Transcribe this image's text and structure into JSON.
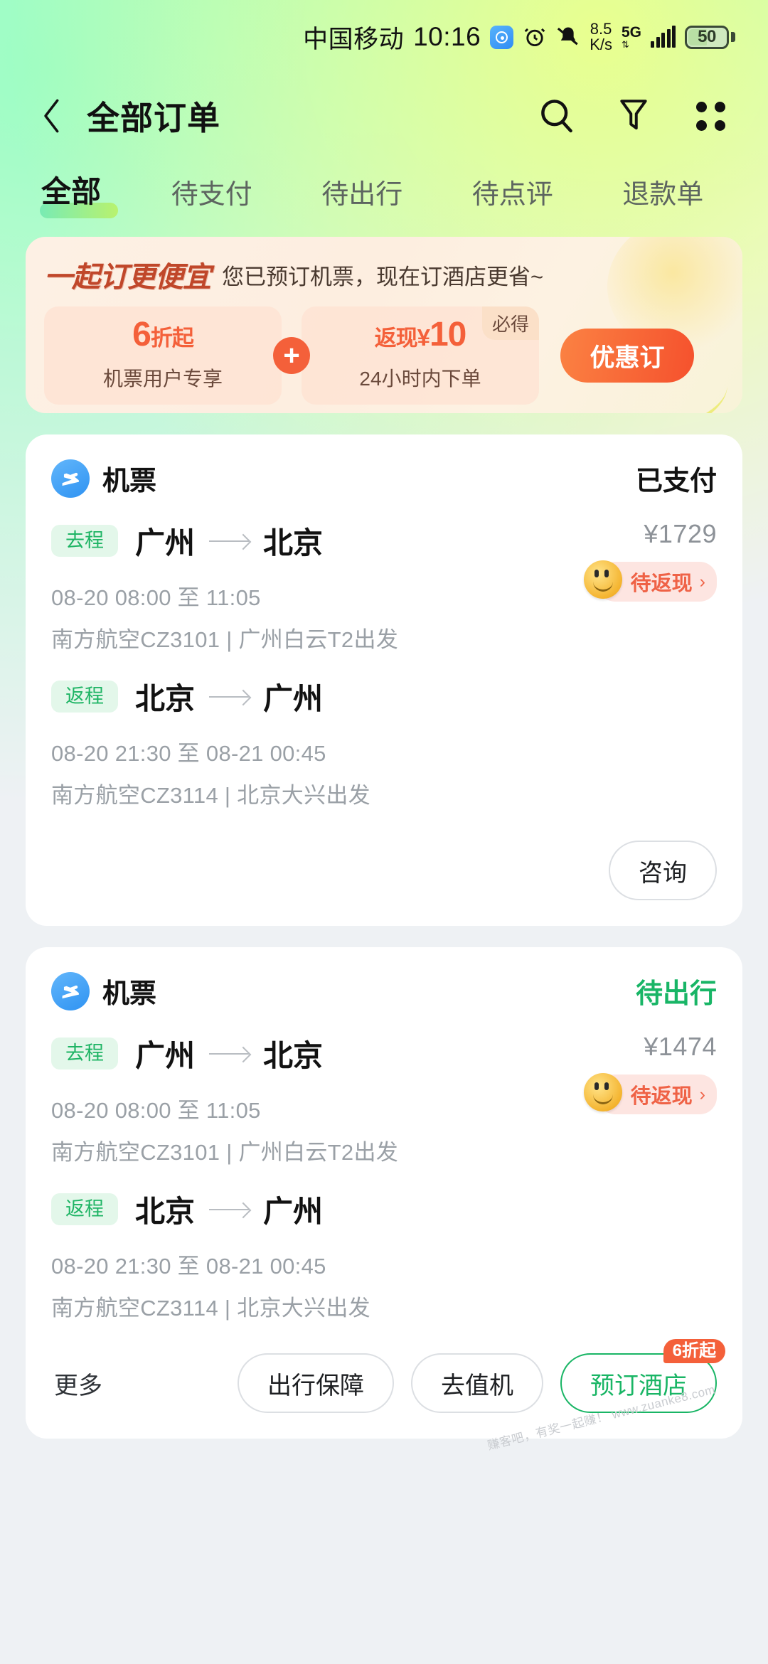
{
  "status_bar": {
    "carrier": "中国移动",
    "time": "10:16",
    "net_speed_value": "8.5",
    "net_speed_unit": "K/s",
    "network_type": "5G",
    "battery": "50",
    "icons": [
      "app-badge-icon",
      "alarm-icon",
      "mute-bell-icon",
      "signal-bars-icon",
      "battery-icon"
    ]
  },
  "nav": {
    "back_icon": "chevron-left-icon",
    "title": "全部订单",
    "search_icon": "search-icon",
    "filter_icon": "filter-funnel-icon",
    "more_icon": "grid-dots-icon"
  },
  "tabs": [
    {
      "label": "全部",
      "active": true
    },
    {
      "label": "待支付",
      "active": false
    },
    {
      "label": "待出行",
      "active": false
    },
    {
      "label": "待点评",
      "active": false
    },
    {
      "label": "退款单",
      "active": false
    }
  ],
  "promo": {
    "kicker": "一起订更便宜",
    "subtitle": "您已预订机票，现在订酒店更省~",
    "left_card": {
      "value": "6",
      "value_suffix": "折起",
      "caption": "机票用户专享"
    },
    "plus": "+",
    "right_card": {
      "prefix": "返现",
      "yen": "¥",
      "value": "10",
      "caption": "24小时内下单",
      "badge": "必得"
    },
    "cta": "优惠订"
  },
  "orders": [
    {
      "icon": "airplane-icon",
      "type": "机票",
      "status": "已支付",
      "status_color": "#121212",
      "price": "¥1729",
      "cashback_label": "待返现",
      "cashback_chevron": "›",
      "segments": [
        {
          "tag": "去程",
          "from": "广州",
          "to": "北京",
          "time": "08-20 08:00 至 11:05",
          "info": "南方航空CZ3101 | 广州白云T2出发"
        },
        {
          "tag": "返程",
          "from": "北京",
          "to": "广州",
          "time": "08-20 21:30 至 08-21 00:45",
          "info": "南方航空CZ3114 | 北京大兴出发"
        }
      ],
      "actions": [
        {
          "label": "咨询",
          "style": "outline",
          "badge": ""
        }
      ],
      "more_label": ""
    },
    {
      "icon": "airplane-icon",
      "type": "机票",
      "status": "待出行",
      "status_color": "#18b566",
      "price": "¥1474",
      "cashback_label": "待返现",
      "cashback_chevron": "›",
      "segments": [
        {
          "tag": "去程",
          "from": "广州",
          "to": "北京",
          "time": "08-20 08:00 至 11:05",
          "info": "南方航空CZ3101 | 广州白云T2出发"
        },
        {
          "tag": "返程",
          "from": "北京",
          "to": "广州",
          "time": "08-20 21:30 至 08-21 00:45",
          "info": "南方航空CZ3114 | 北京大兴出发"
        }
      ],
      "actions": [
        {
          "label": "出行保障",
          "style": "outline",
          "badge": ""
        },
        {
          "label": "去值机",
          "style": "outline",
          "badge": ""
        },
        {
          "label": "预订酒店",
          "style": "green",
          "badge": "6折起"
        }
      ],
      "more_label": "更多"
    }
  ],
  "watermark": "赚客吧，有奖一起赚！\nwww.zuanke8.com"
}
